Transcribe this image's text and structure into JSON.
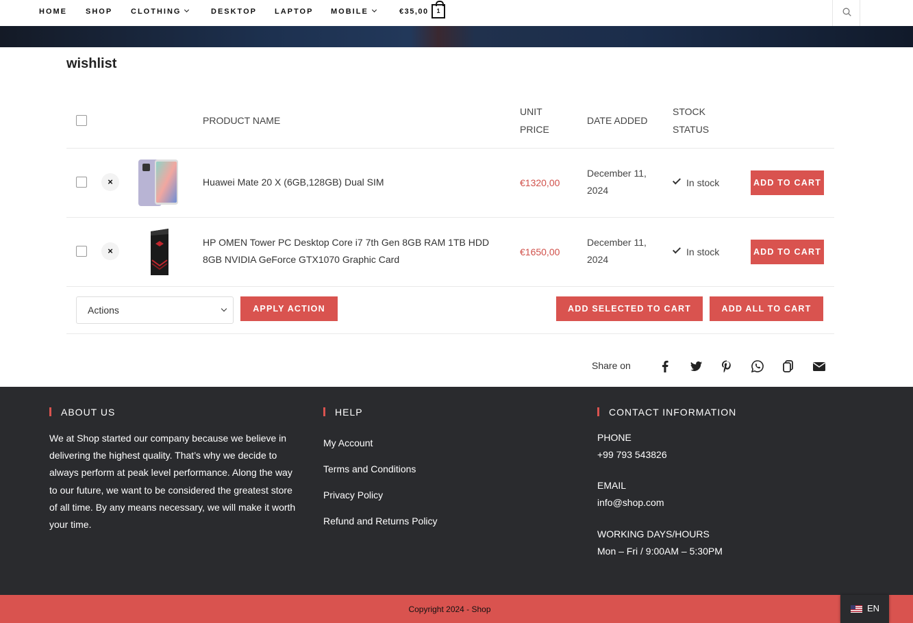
{
  "nav": {
    "items": [
      {
        "label": "HOME",
        "dropdown": false
      },
      {
        "label": "SHOP",
        "dropdown": false
      },
      {
        "label": "CLOTHING",
        "dropdown": true
      },
      {
        "label": "DESKTOP",
        "dropdown": false
      },
      {
        "label": "LAPTOP",
        "dropdown": false
      },
      {
        "label": "MOBILE",
        "dropdown": true
      }
    ],
    "cart_total": "€35,00",
    "cart_count": "1",
    "search_icon": "search-icon"
  },
  "page": {
    "title": "wishlist"
  },
  "table": {
    "headers": {
      "product_name": "PRODUCT NAME",
      "unit_price_1": "UNIT",
      "unit_price_2": "PRICE",
      "date_added": "DATE ADDED",
      "stock_1": "STOCK",
      "stock_2": "STATUS"
    },
    "rows": [
      {
        "name": "Huawei Mate 20 X (6GB,128GB) Dual SIM",
        "price": "€1320,00",
        "date_1": "December 11,",
        "date_2": "2024",
        "stock": "In stock",
        "button": "ADD TO CART",
        "remove": "×"
      },
      {
        "name_1": "HP OMEN Tower PC Desktop Core i7 7th Gen 8GB RAM 1TB HDD",
        "name_2": "8GB NVIDIA GeForce GTX1070 Graphic Card",
        "price": "€1650,00",
        "date_1": "December 11,",
        "date_2": "2024",
        "stock": "In stock",
        "button": "ADD TO CART",
        "remove": "×"
      }
    ],
    "actions": {
      "select_value": "Actions",
      "apply": "APPLY ACTION",
      "add_selected": "ADD SELECTED TO CART",
      "add_all": "ADD ALL TO CART"
    }
  },
  "share": {
    "label": "Share on",
    "icons": [
      "facebook-icon",
      "twitter-icon",
      "pinterest-icon",
      "whatsapp-icon",
      "copy-icon",
      "email-icon"
    ]
  },
  "footer": {
    "about": {
      "heading": "ABOUT US",
      "text": "We at Shop started our company because we believe in delivering the highest quality. That’s why we decide to always perform at peak level performance. Along the way to our future, we want to be considered the greatest store of all time. By any means necessary, we will make it worth your time."
    },
    "help": {
      "heading": "HELP",
      "links": [
        "My Account",
        "Terms and Conditions",
        "Privacy Policy",
        "Refund and Returns Policy"
      ]
    },
    "contact": {
      "heading": "CONTACT INFORMATION",
      "phone_label": "PHONE",
      "phone": "+99 793 543826",
      "email_label": "EMAIL",
      "email": "info@shop.com",
      "hours_label": "WORKING DAYS/HOURS",
      "hours": "Mon – Fri / 9:00AM – 5:30PM"
    },
    "copyright": "Copyright 2024 - Shop",
    "language": "EN"
  },
  "colors": {
    "accent": "#d9534f",
    "footer_bg": "#2a2b2e",
    "price": "#d0504a"
  }
}
